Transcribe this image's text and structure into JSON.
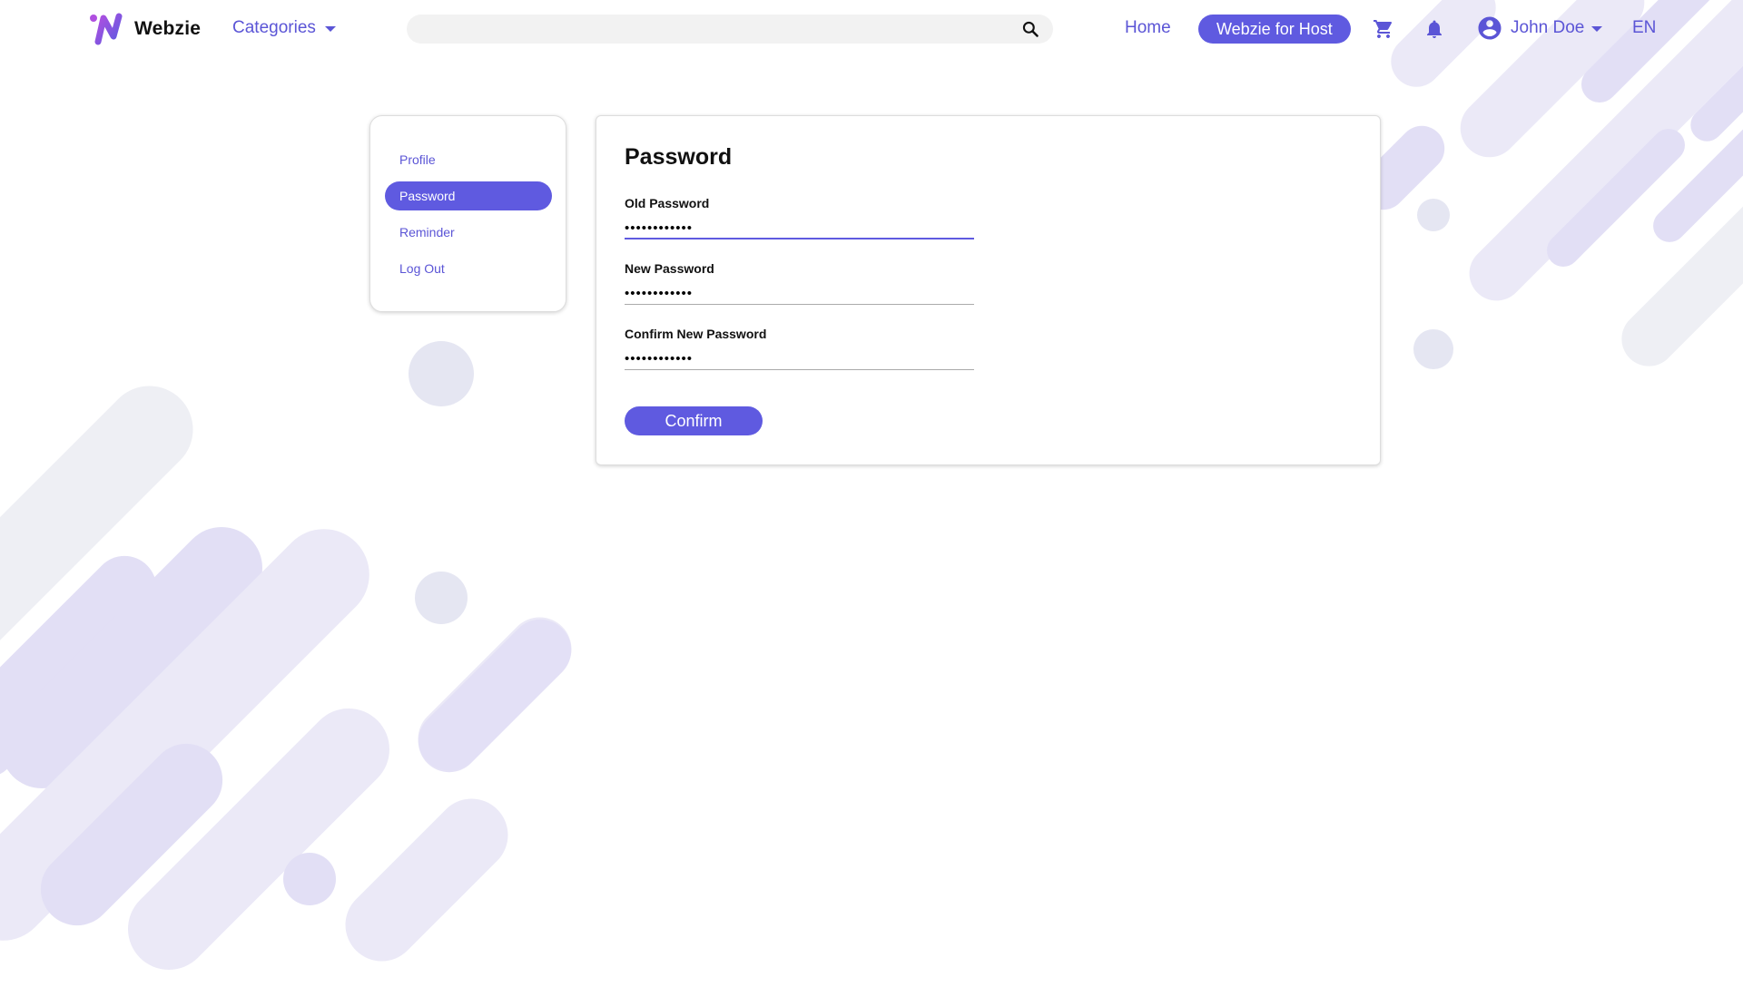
{
  "header": {
    "brand": "Webzie",
    "categories_label": "Categories",
    "search_placeholder": "",
    "home_label": "Home",
    "host_label": "Webzie for Host",
    "user_name": "John Doe",
    "language": "EN"
  },
  "sidebar": {
    "items": [
      {
        "label": "Profile",
        "active": false
      },
      {
        "label": "Password",
        "active": true
      },
      {
        "label": "Reminder",
        "active": false
      },
      {
        "label": "Log Out",
        "active": false
      }
    ]
  },
  "form": {
    "title": "Password",
    "fields": [
      {
        "label": "Old Password",
        "value": "••••••••••••"
      },
      {
        "label": "New Password",
        "value": "••••••••••••"
      },
      {
        "label": "Confirm New Password",
        "value": "••••••••••••"
      }
    ],
    "confirm_label": "Confirm"
  },
  "colors": {
    "accent": "#5f5ae0",
    "link": "#5b55d6",
    "shape_light": "#ebe9f7",
    "shape_mid": "#e2dff5",
    "shape_gray": "#eeeff4"
  },
  "icons": [
    "search-icon",
    "cart-icon",
    "bell-icon",
    "account-circle-icon",
    "chevron-down-icon"
  ]
}
